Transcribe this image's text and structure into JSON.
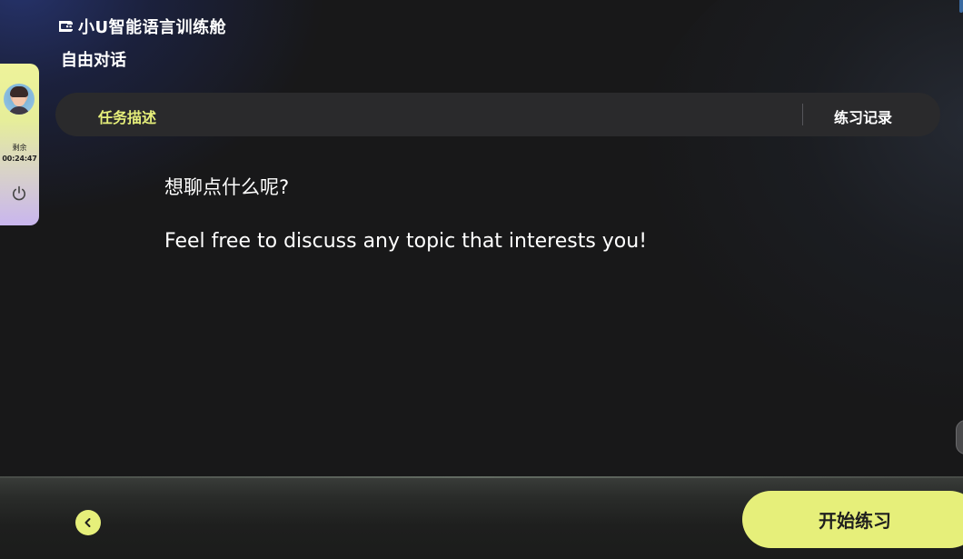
{
  "header": {
    "brand_icon": "app-logo-icon",
    "brand_title": "小U智能语言训练舱",
    "page_title": "自由对话"
  },
  "side_panel": {
    "avatar": "user-avatar",
    "remain_label": "剩余",
    "remain_time": "00:24:47",
    "power_icon": "power-icon"
  },
  "tabs": {
    "task_label": "任务描述",
    "record_label": "练习记录"
  },
  "content": {
    "prompt_cn": "想聊点什么呢?",
    "prompt_en": "Feel free to discuss any topic that interests you!"
  },
  "footer": {
    "back_icon": "chevron-left-icon",
    "start_label": "开始练习"
  },
  "colors": {
    "accent": "#e6ef7a",
    "background": "#181819",
    "tab_bar": "#2a2a2c"
  }
}
